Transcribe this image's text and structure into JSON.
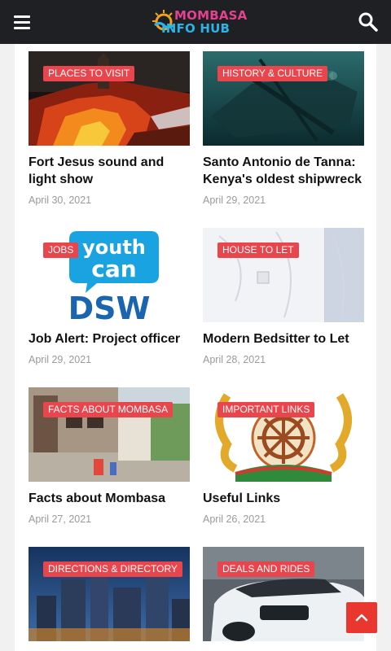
{
  "header": {
    "logo_line1": "MOMBASA",
    "logo_line2": "INFO HUB",
    "menu_icon": "hamburger-menu-icon",
    "search_icon": "search-icon",
    "brand_colors": {
      "mombasa": "#e4418f",
      "info_hub": "#29b3e8",
      "bar": "#1f2024"
    }
  },
  "accent_color": "#e9454c",
  "posts": [
    {
      "category": "Places to Visit",
      "title": "Fort Jesus sound and light show",
      "date": "April 30, 2021"
    },
    {
      "category": "History & Culture",
      "title": "Santo Antonio de Tanna: Kenya's oldest shipwreck",
      "date": "April 29, 2021"
    },
    {
      "category": "Jobs",
      "title": "Job Alert: Project officer",
      "date": "April 29, 2021",
      "image_text": {
        "line1": "youth",
        "line2": "can",
        "line3": "DSW"
      }
    },
    {
      "category": "House To Let",
      "title": "Modern Bedsitter to Let",
      "date": "April 28, 2021"
    },
    {
      "category": "Facts About Mombasa",
      "title": "Facts about Mombasa",
      "date": "April 27, 2021"
    },
    {
      "category": "Important Links",
      "title": "Useful Links",
      "date": "April 26, 2021"
    },
    {
      "category": "Directions & Directory",
      "title": "",
      "date": ""
    },
    {
      "category": "Deals And Rides",
      "title": "",
      "date": ""
    }
  ],
  "back_to_top_icon": "chevron-up-icon"
}
